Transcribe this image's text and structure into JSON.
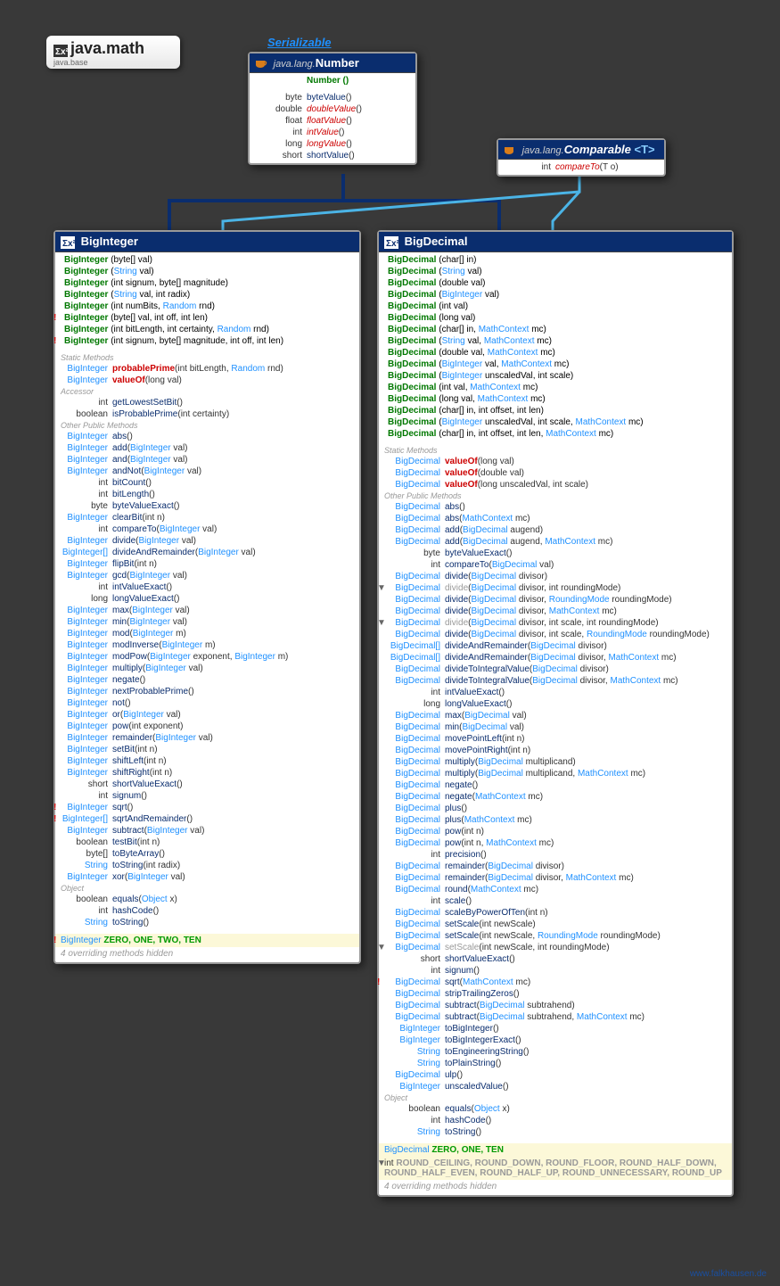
{
  "package": {
    "name": "java.math",
    "module": "java.base"
  },
  "serializable_label": "Serializable",
  "footer": "www.falkhausen.de",
  "number_box": {
    "pkg": "java.lang.",
    "name": "Number",
    "ctor": "Number ()",
    "methods": [
      {
        "ret": "byte",
        "name": "byteValue",
        "p": "()"
      },
      {
        "ret": "double",
        "name": "doubleValue",
        "p": "()",
        "abs": true
      },
      {
        "ret": "float",
        "name": "floatValue",
        "p": "()",
        "abs": true
      },
      {
        "ret": "int",
        "name": "intValue",
        "p": "()",
        "abs": true
      },
      {
        "ret": "long",
        "name": "longValue",
        "p": "()",
        "abs": true
      },
      {
        "ret": "short",
        "name": "shortValue",
        "p": "()"
      }
    ]
  },
  "comparable_box": {
    "pkg": "java.lang.",
    "name": "Comparable",
    "tparam": "<T>",
    "methods": [
      {
        "ret": "int",
        "name": "compareTo",
        "p": "(T o)",
        "abs": true
      }
    ]
  },
  "biginteger": {
    "title": "BigInteger",
    "ctors": [
      {
        "sig": "BigInteger (byte[] val)"
      },
      {
        "sig": "BigInteger (String val)",
        "types": [
          "String"
        ]
      },
      {
        "sig": "BigInteger (int signum, byte[] magnitude)"
      },
      {
        "sig": "BigInteger (String val, int radix)",
        "types": [
          "String"
        ]
      },
      {
        "sig": "BigInteger (int numBits, Random rnd)",
        "types": [
          "Random"
        ]
      },
      {
        "sig": "BigInteger (byte[] val, int off, int len)",
        "bang": true
      },
      {
        "sig": "BigInteger (int bitLength, int certainty, Random rnd)",
        "types": [
          "Random"
        ]
      },
      {
        "sig": "BigInteger (int signum, byte[] magnitude, int off, int len)",
        "bang": true
      }
    ],
    "static_methods": [
      {
        "ret": "BigInteger",
        "name": "probablePrime",
        "p": "(int bitLength, Random rnd)",
        "red": true,
        "ptypes": [
          "Random"
        ]
      },
      {
        "ret": "BigInteger",
        "name": "valueOf",
        "p": "(long val)",
        "red": true
      }
    ],
    "accessor": [
      {
        "ret": "int",
        "name": "getLowestSetBit",
        "p": "()"
      },
      {
        "ret": "boolean",
        "name": "isProbablePrime",
        "p": "(int certainty)"
      }
    ],
    "methods": [
      {
        "ret": "BigInteger",
        "name": "abs",
        "p": "()"
      },
      {
        "ret": "BigInteger",
        "name": "add",
        "p": "(BigInteger val)",
        "ptypes": [
          "BigInteger"
        ]
      },
      {
        "ret": "BigInteger",
        "name": "and",
        "p": "(BigInteger val)",
        "ptypes": [
          "BigInteger"
        ]
      },
      {
        "ret": "BigInteger",
        "name": "andNot",
        "p": "(BigInteger val)",
        "ptypes": [
          "BigInteger"
        ]
      },
      {
        "ret": "int",
        "name": "bitCount",
        "p": "()"
      },
      {
        "ret": "int",
        "name": "bitLength",
        "p": "()"
      },
      {
        "ret": "byte",
        "name": "byteValueExact",
        "p": "()"
      },
      {
        "ret": "BigInteger",
        "name": "clearBit",
        "p": "(int n)"
      },
      {
        "ret": "int",
        "name": "compareTo",
        "p": "(BigInteger val)",
        "ptypes": [
          "BigInteger"
        ]
      },
      {
        "ret": "BigInteger",
        "name": "divide",
        "p": "(BigInteger val)",
        "ptypes": [
          "BigInteger"
        ]
      },
      {
        "ret": "BigInteger[]",
        "name": "divideAndRemainder",
        "p": "(BigInteger val)",
        "ptypes": [
          "BigInteger"
        ]
      },
      {
        "ret": "BigInteger",
        "name": "flipBit",
        "p": "(int n)"
      },
      {
        "ret": "BigInteger",
        "name": "gcd",
        "p": "(BigInteger val)",
        "ptypes": [
          "BigInteger"
        ]
      },
      {
        "ret": "int",
        "name": "intValueExact",
        "p": "()"
      },
      {
        "ret": "long",
        "name": "longValueExact",
        "p": "()"
      },
      {
        "ret": "BigInteger",
        "name": "max",
        "p": "(BigInteger val)",
        "ptypes": [
          "BigInteger"
        ]
      },
      {
        "ret": "BigInteger",
        "name": "min",
        "p": "(BigInteger val)",
        "ptypes": [
          "BigInteger"
        ]
      },
      {
        "ret": "BigInteger",
        "name": "mod",
        "p": "(BigInteger m)",
        "ptypes": [
          "BigInteger"
        ]
      },
      {
        "ret": "BigInteger",
        "name": "modInverse",
        "p": "(BigInteger m)",
        "ptypes": [
          "BigInteger"
        ]
      },
      {
        "ret": "BigInteger",
        "name": "modPow",
        "p": "(BigInteger exponent, BigInteger m)",
        "ptypes": [
          "BigInteger",
          "BigInteger"
        ]
      },
      {
        "ret": "BigInteger",
        "name": "multiply",
        "p": "(BigInteger val)",
        "ptypes": [
          "BigInteger"
        ]
      },
      {
        "ret": "BigInteger",
        "name": "negate",
        "p": "()"
      },
      {
        "ret": "BigInteger",
        "name": "nextProbablePrime",
        "p": "()"
      },
      {
        "ret": "BigInteger",
        "name": "not",
        "p": "()"
      },
      {
        "ret": "BigInteger",
        "name": "or",
        "p": "(BigInteger val)",
        "ptypes": [
          "BigInteger"
        ]
      },
      {
        "ret": "BigInteger",
        "name": "pow",
        "p": "(int exponent)"
      },
      {
        "ret": "BigInteger",
        "name": "remainder",
        "p": "(BigInteger val)",
        "ptypes": [
          "BigInteger"
        ]
      },
      {
        "ret": "BigInteger",
        "name": "setBit",
        "p": "(int n)"
      },
      {
        "ret": "BigInteger",
        "name": "shiftLeft",
        "p": "(int n)"
      },
      {
        "ret": "BigInteger",
        "name": "shiftRight",
        "p": "(int n)"
      },
      {
        "ret": "short",
        "name": "shortValueExact",
        "p": "()"
      },
      {
        "ret": "int",
        "name": "signum",
        "p": "()"
      },
      {
        "ret": "BigInteger",
        "name": "sqrt",
        "p": "()",
        "bang": true
      },
      {
        "ret": "BigInteger[]",
        "name": "sqrtAndRemainder",
        "p": "()",
        "bang": true
      },
      {
        "ret": "BigInteger",
        "name": "subtract",
        "p": "(BigInteger val)",
        "ptypes": [
          "BigInteger"
        ]
      },
      {
        "ret": "boolean",
        "name": "testBit",
        "p": "(int n)"
      },
      {
        "ret": "byte[]",
        "name": "toByteArray",
        "p": "()"
      },
      {
        "ret": "String",
        "name": "toString",
        "p": "(int radix)",
        "rettype": "String"
      },
      {
        "ret": "BigInteger",
        "name": "xor",
        "p": "(BigInteger val)",
        "ptypes": [
          "BigInteger"
        ]
      }
    ],
    "object": [
      {
        "ret": "boolean",
        "name": "equals",
        "p": "(Object x)",
        "ptypes": [
          "Object"
        ]
      },
      {
        "ret": "int",
        "name": "hashCode",
        "p": "()"
      },
      {
        "ret": "String",
        "name": "toString",
        "p": "()",
        "rettype": "String"
      }
    ],
    "constants": {
      "type": "BigInteger",
      "names": "ZERO, ONE, TWO, TEN",
      "bang": true
    },
    "hidden": "4 overriding methods hidden"
  },
  "bigdecimal": {
    "title": "BigDecimal",
    "ctors": [
      {
        "sig": "BigDecimal (char[] in)"
      },
      {
        "sig": "BigDecimal (String val)",
        "types": [
          "String"
        ]
      },
      {
        "sig": "BigDecimal (double val)"
      },
      {
        "sig": "BigDecimal (BigInteger val)",
        "types": [
          "BigInteger"
        ]
      },
      {
        "sig": "BigDecimal (int val)"
      },
      {
        "sig": "BigDecimal (long val)"
      },
      {
        "sig": "BigDecimal (char[] in, MathContext mc)",
        "types": [
          "MathContext"
        ]
      },
      {
        "sig": "BigDecimal (String val, MathContext mc)",
        "types": [
          "String",
          "MathContext"
        ]
      },
      {
        "sig": "BigDecimal (double val, MathContext mc)",
        "types": [
          "MathContext"
        ]
      },
      {
        "sig": "BigDecimal (BigInteger val, MathContext mc)",
        "types": [
          "BigInteger",
          "MathContext"
        ]
      },
      {
        "sig": "BigDecimal (BigInteger unscaledVal, int scale)",
        "types": [
          "BigInteger"
        ]
      },
      {
        "sig": "BigDecimal (int val, MathContext mc)",
        "types": [
          "MathContext"
        ]
      },
      {
        "sig": "BigDecimal (long val, MathContext mc)",
        "types": [
          "MathContext"
        ]
      },
      {
        "sig": "BigDecimal (char[] in, int offset, int len)"
      },
      {
        "sig": "BigDecimal (BigInteger unscaledVal, int scale, MathContext mc)",
        "types": [
          "BigInteger",
          "MathContext"
        ]
      },
      {
        "sig": "BigDecimal (char[] in, int offset, int len, MathContext mc)",
        "types": [
          "MathContext"
        ]
      }
    ],
    "static_methods": [
      {
        "ret": "BigDecimal",
        "name": "valueOf",
        "p": "(long val)",
        "red": true
      },
      {
        "ret": "BigDecimal",
        "name": "valueOf",
        "p": "(double val)",
        "red": true
      },
      {
        "ret": "BigDecimal",
        "name": "valueOf",
        "p": "(long unscaledVal, int scale)",
        "red": true
      }
    ],
    "methods": [
      {
        "ret": "BigDecimal",
        "name": "abs",
        "p": "()"
      },
      {
        "ret": "BigDecimal",
        "name": "abs",
        "p": "(MathContext mc)",
        "ptypes": [
          "MathContext"
        ]
      },
      {
        "ret": "BigDecimal",
        "name": "add",
        "p": "(BigDecimal augend)",
        "ptypes": [
          "BigDecimal"
        ]
      },
      {
        "ret": "BigDecimal",
        "name": "add",
        "p": "(BigDecimal augend, MathContext mc)",
        "ptypes": [
          "BigDecimal",
          "MathContext"
        ]
      },
      {
        "ret": "byte",
        "name": "byteValueExact",
        "p": "()"
      },
      {
        "ret": "int",
        "name": "compareTo",
        "p": "(BigDecimal val)",
        "ptypes": [
          "BigDecimal"
        ]
      },
      {
        "ret": "BigDecimal",
        "name": "divide",
        "p": "(BigDecimal divisor)",
        "ptypes": [
          "BigDecimal"
        ]
      },
      {
        "ret": "BigDecimal",
        "name": "divide",
        "p": "(BigDecimal divisor, int roundingMode)",
        "ptypes": [
          "BigDecimal"
        ],
        "dep": true,
        "down": true
      },
      {
        "ret": "BigDecimal",
        "name": "divide",
        "p": "(BigDecimal divisor, RoundingMode roundingMode)",
        "ptypes": [
          "BigDecimal",
          "RoundingMode"
        ]
      },
      {
        "ret": "BigDecimal",
        "name": "divide",
        "p": "(BigDecimal divisor, MathContext mc)",
        "ptypes": [
          "BigDecimal",
          "MathContext"
        ]
      },
      {
        "ret": "BigDecimal",
        "name": "divide",
        "p": "(BigDecimal divisor, int scale, int roundingMode)",
        "ptypes": [
          "BigDecimal"
        ],
        "dep": true,
        "down": true
      },
      {
        "ret": "BigDecimal",
        "name": "divide",
        "p": "(BigDecimal divisor, int scale, RoundingMode roundingMode)",
        "ptypes": [
          "BigDecimal",
          "RoundingMode"
        ]
      },
      {
        "ret": "BigDecimal[]",
        "name": "divideAndRemainder",
        "p": "(BigDecimal divisor)",
        "ptypes": [
          "BigDecimal"
        ]
      },
      {
        "ret": "BigDecimal[]",
        "name": "divideAndRemainder",
        "p": "(BigDecimal divisor, MathContext mc)",
        "ptypes": [
          "BigDecimal",
          "MathContext"
        ]
      },
      {
        "ret": "BigDecimal",
        "name": "divideToIntegralValue",
        "p": "(BigDecimal divisor)",
        "ptypes": [
          "BigDecimal"
        ]
      },
      {
        "ret": "BigDecimal",
        "name": "divideToIntegralValue",
        "p": "(BigDecimal divisor, MathContext mc)",
        "ptypes": [
          "BigDecimal",
          "MathContext"
        ]
      },
      {
        "ret": "int",
        "name": "intValueExact",
        "p": "()"
      },
      {
        "ret": "long",
        "name": "longValueExact",
        "p": "()"
      },
      {
        "ret": "BigDecimal",
        "name": "max",
        "p": "(BigDecimal val)",
        "ptypes": [
          "BigDecimal"
        ]
      },
      {
        "ret": "BigDecimal",
        "name": "min",
        "p": "(BigDecimal val)",
        "ptypes": [
          "BigDecimal"
        ]
      },
      {
        "ret": "BigDecimal",
        "name": "movePointLeft",
        "p": "(int n)"
      },
      {
        "ret": "BigDecimal",
        "name": "movePointRight",
        "p": "(int n)"
      },
      {
        "ret": "BigDecimal",
        "name": "multiply",
        "p": "(BigDecimal multiplicand)",
        "ptypes": [
          "BigDecimal"
        ]
      },
      {
        "ret": "BigDecimal",
        "name": "multiply",
        "p": "(BigDecimal multiplicand, MathContext mc)",
        "ptypes": [
          "BigDecimal",
          "MathContext"
        ]
      },
      {
        "ret": "BigDecimal",
        "name": "negate",
        "p": "()"
      },
      {
        "ret": "BigDecimal",
        "name": "negate",
        "p": "(MathContext mc)",
        "ptypes": [
          "MathContext"
        ]
      },
      {
        "ret": "BigDecimal",
        "name": "plus",
        "p": "()"
      },
      {
        "ret": "BigDecimal",
        "name": "plus",
        "p": "(MathContext mc)",
        "ptypes": [
          "MathContext"
        ]
      },
      {
        "ret": "BigDecimal",
        "name": "pow",
        "p": "(int n)"
      },
      {
        "ret": "BigDecimal",
        "name": "pow",
        "p": "(int n, MathContext mc)",
        "ptypes": [
          "MathContext"
        ]
      },
      {
        "ret": "int",
        "name": "precision",
        "p": "()"
      },
      {
        "ret": "BigDecimal",
        "name": "remainder",
        "p": "(BigDecimal divisor)",
        "ptypes": [
          "BigDecimal"
        ]
      },
      {
        "ret": "BigDecimal",
        "name": "remainder",
        "p": "(BigDecimal divisor, MathContext mc)",
        "ptypes": [
          "BigDecimal",
          "MathContext"
        ]
      },
      {
        "ret": "BigDecimal",
        "name": "round",
        "p": "(MathContext mc)",
        "ptypes": [
          "MathContext"
        ]
      },
      {
        "ret": "int",
        "name": "scale",
        "p": "()"
      },
      {
        "ret": "BigDecimal",
        "name": "scaleByPowerOfTen",
        "p": "(int n)"
      },
      {
        "ret": "BigDecimal",
        "name": "setScale",
        "p": "(int newScale)"
      },
      {
        "ret": "BigDecimal",
        "name": "setScale",
        "p": "(int newScale, RoundingMode roundingMode)",
        "ptypes": [
          "RoundingMode"
        ]
      },
      {
        "ret": "BigDecimal",
        "name": "setScale",
        "p": "(int newScale, int roundingMode)",
        "dep": true,
        "down": true
      },
      {
        "ret": "short",
        "name": "shortValueExact",
        "p": "()"
      },
      {
        "ret": "int",
        "name": "signum",
        "p": "()"
      },
      {
        "ret": "BigDecimal",
        "name": "sqrt",
        "p": "(MathContext mc)",
        "ptypes": [
          "MathContext"
        ],
        "bang": true
      },
      {
        "ret": "BigDecimal",
        "name": "stripTrailingZeros",
        "p": "()"
      },
      {
        "ret": "BigDecimal",
        "name": "subtract",
        "p": "(BigDecimal subtrahend)",
        "ptypes": [
          "BigDecimal"
        ]
      },
      {
        "ret": "BigDecimal",
        "name": "subtract",
        "p": "(BigDecimal subtrahend, MathContext mc)",
        "ptypes": [
          "BigDecimal",
          "MathContext"
        ]
      },
      {
        "ret": "BigInteger",
        "name": "toBigInteger",
        "p": "()"
      },
      {
        "ret": "BigInteger",
        "name": "toBigIntegerExact",
        "p": "()"
      },
      {
        "ret": "String",
        "name": "toEngineeringString",
        "p": "()",
        "rettype": "String"
      },
      {
        "ret": "String",
        "name": "toPlainString",
        "p": "()",
        "rettype": "String"
      },
      {
        "ret": "BigDecimal",
        "name": "ulp",
        "p": "()"
      },
      {
        "ret": "BigInteger",
        "name": "unscaledValue",
        "p": "()"
      }
    ],
    "object": [
      {
        "ret": "boolean",
        "name": "equals",
        "p": "(Object x)",
        "ptypes": [
          "Object"
        ]
      },
      {
        "ret": "int",
        "name": "hashCode",
        "p": "()"
      },
      {
        "ret": "String",
        "name": "toString",
        "p": "()",
        "rettype": "String"
      }
    ],
    "constants": [
      {
        "type": "BigDecimal",
        "names": "ZERO, ONE, TEN"
      },
      {
        "type": "int",
        "names": "ROUND_CEILING, ROUND_DOWN, ROUND_FLOOR, ROUND_HALF_DOWN, ROUND_HALF_EVEN, ROUND_HALF_UP, ROUND_UNNECESSARY, ROUND_UP",
        "dep": true,
        "down": true
      }
    ],
    "hidden": "4 overriding methods hidden"
  }
}
